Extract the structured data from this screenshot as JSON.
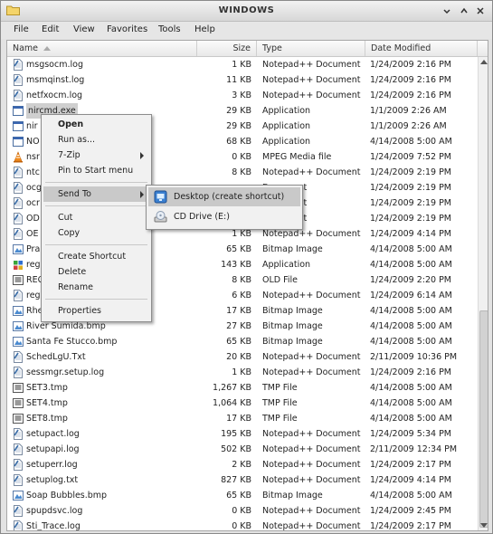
{
  "window": {
    "title": "WINDOWS"
  },
  "menu": [
    "File",
    "Edit",
    "View",
    "Favorites",
    "Tools",
    "Help"
  ],
  "columns": {
    "name": "Name",
    "size": "Size",
    "type": "Type",
    "date": "Date Modified"
  },
  "rows": [
    {
      "name": "msgsocm.log",
      "size": "1 KB",
      "type": "Notepad++ Document",
      "date": "1/24/2009 2:16 PM",
      "icon": "document-icon"
    },
    {
      "name": "msmqinst.log",
      "size": "11 KB",
      "type": "Notepad++ Document",
      "date": "1/24/2009 2:16 PM",
      "icon": "document-icon"
    },
    {
      "name": "netfxocm.log",
      "size": "3 KB",
      "type": "Notepad++ Document",
      "date": "1/24/2009 2:16 PM",
      "icon": "document-icon"
    },
    {
      "name": "nircmd.exe",
      "size": "29 KB",
      "type": "Application",
      "date": "1/1/2009 2:26 AM",
      "icon": "application-icon",
      "selected": true
    },
    {
      "name": "nir",
      "size": "29 KB",
      "type": "Application",
      "date": "1/1/2009 2:26 AM",
      "icon": "application-icon"
    },
    {
      "name": "NO",
      "size": "68 KB",
      "type": "Application",
      "date": "4/14/2008 5:00 AM",
      "icon": "application-icon"
    },
    {
      "name": "nsr",
      "size": "0 KB",
      "type": "MPEG Media file",
      "date": "1/24/2009 7:52 PM",
      "icon": "vlc-cone-icon"
    },
    {
      "name": "ntc",
      "size": "8 KB",
      "type": "Notepad++ Document",
      "date": "1/24/2009 2:19 PM",
      "icon": "document-icon"
    },
    {
      "name": "ocg",
      "size": "",
      "type": "Document",
      "date": "1/24/2009 2:19 PM",
      "icon": "document-icon"
    },
    {
      "name": "ocr",
      "size": "",
      "type": "Document",
      "date": "1/24/2009 2:19 PM",
      "icon": "document-icon"
    },
    {
      "name": "OD",
      "size": "",
      "type": "Document",
      "date": "1/24/2009 2:19 PM",
      "icon": "document-icon"
    },
    {
      "name": "OE",
      "size": "1 KB",
      "type": "Notepad++ Document",
      "date": "1/24/2009 4:14 PM",
      "icon": "document-icon"
    },
    {
      "name": "Pra",
      "size": "65 KB",
      "type": "Bitmap Image",
      "date": "4/14/2008 5:00 AM",
      "icon": "bitmap-icon"
    },
    {
      "name": "reg",
      "size": "143 KB",
      "type": "Application",
      "date": "4/14/2008 5:00 AM",
      "icon": "registry-icon"
    },
    {
      "name": "REC",
      "size": "8 KB",
      "type": "OLD File",
      "date": "1/24/2009 2:20 PM",
      "icon": "file-icon"
    },
    {
      "name": "reg",
      "size": "6 KB",
      "type": "Notepad++ Document",
      "date": "1/24/2009 6:14 AM",
      "icon": "document-icon"
    },
    {
      "name": "Rhe",
      "size": "17 KB",
      "type": "Bitmap Image",
      "date": "4/14/2008 5:00 AM",
      "icon": "bitmap-icon"
    },
    {
      "name": "River Sumida.bmp",
      "size": "27 KB",
      "type": "Bitmap Image",
      "date": "4/14/2008 5:00 AM",
      "icon": "bitmap-icon"
    },
    {
      "name": "Santa Fe Stucco.bmp",
      "size": "65 KB",
      "type": "Bitmap Image",
      "date": "4/14/2008 5:00 AM",
      "icon": "bitmap-icon"
    },
    {
      "name": "SchedLgU.Txt",
      "size": "20 KB",
      "type": "Notepad++ Document",
      "date": "2/11/2009 10:36 PM",
      "icon": "document-icon"
    },
    {
      "name": "sessmgr.setup.log",
      "size": "1 KB",
      "type": "Notepad++ Document",
      "date": "1/24/2009 2:16 PM",
      "icon": "document-icon"
    },
    {
      "name": "SET3.tmp",
      "size": "1,267 KB",
      "type": "TMP File",
      "date": "4/14/2008 5:00 AM",
      "icon": "file-icon"
    },
    {
      "name": "SET4.tmp",
      "size": "1,064 KB",
      "type": "TMP File",
      "date": "4/14/2008 5:00 AM",
      "icon": "file-icon"
    },
    {
      "name": "SET8.tmp",
      "size": "17 KB",
      "type": "TMP File",
      "date": "4/14/2008 5:00 AM",
      "icon": "file-icon"
    },
    {
      "name": "setupact.log",
      "size": "195 KB",
      "type": "Notepad++ Document",
      "date": "1/24/2009 5:34 PM",
      "icon": "document-icon"
    },
    {
      "name": "setupapi.log",
      "size": "502 KB",
      "type": "Notepad++ Document",
      "date": "2/11/2009 12:34 PM",
      "icon": "document-icon"
    },
    {
      "name": "setuperr.log",
      "size": "2 KB",
      "type": "Notepad++ Document",
      "date": "1/24/2009 2:17 PM",
      "icon": "document-icon"
    },
    {
      "name": "setuplog.txt",
      "size": "827 KB",
      "type": "Notepad++ Document",
      "date": "1/24/2009 4:14 PM",
      "icon": "document-icon"
    },
    {
      "name": "Soap Bubbles.bmp",
      "size": "65 KB",
      "type": "Bitmap Image",
      "date": "4/14/2008 5:00 AM",
      "icon": "bitmap-icon"
    },
    {
      "name": "spupdsvc.log",
      "size": "0 KB",
      "type": "Notepad++ Document",
      "date": "1/24/2009 2:45 PM",
      "icon": "document-icon"
    },
    {
      "name": "Sti_Trace.log",
      "size": "0 KB",
      "type": "Notepad++ Document",
      "date": "1/24/2009 2:17 PM",
      "icon": "document-icon"
    }
  ],
  "context_menu": {
    "items": [
      {
        "label": "Open",
        "bold": true
      },
      {
        "label": "Run as..."
      },
      {
        "label": "7-Zip",
        "submenu": true
      },
      {
        "label": "Pin to Start menu"
      },
      {
        "sep": true
      },
      {
        "label": "Send To",
        "submenu": true,
        "highlighted": true
      },
      {
        "sep": true
      },
      {
        "label": "Cut"
      },
      {
        "label": "Copy"
      },
      {
        "sep": true
      },
      {
        "label": "Create Shortcut"
      },
      {
        "label": "Delete"
      },
      {
        "label": "Rename"
      },
      {
        "sep": true
      },
      {
        "label": "Properties"
      }
    ]
  },
  "send_to_menu": {
    "items": [
      {
        "label": "Desktop (create shortcut)",
        "icon": "desktop-icon",
        "highlighted": true
      },
      {
        "label": "CD Drive (E:)",
        "icon": "cd-drive-icon"
      }
    ]
  },
  "colors": {
    "highlight": "#c9c9c9",
    "window_bg": "#e3e3e3"
  }
}
